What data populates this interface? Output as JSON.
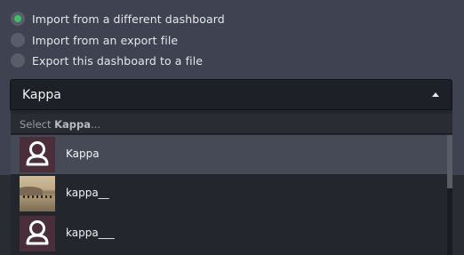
{
  "radio_options": [
    {
      "label": "Import from a different dashboard",
      "checked": true
    },
    {
      "label": "Import from an export file",
      "checked": false
    },
    {
      "label": "Export this dashboard to a file",
      "checked": false
    }
  ],
  "select": {
    "value": "Kappa",
    "search_prefix": "Select ",
    "search_term": "Kappa",
    "search_suffix": "..."
  },
  "options": [
    {
      "label": "Kappa",
      "icon": "user-icon",
      "selected": true
    },
    {
      "label": "kappa__",
      "icon": "photo-thumbnail",
      "selected": false
    },
    {
      "label": "kappa___",
      "icon": "user-icon",
      "selected": false
    }
  ],
  "colors": {
    "accent": "#3fbf6b",
    "panel": "#3f4250",
    "dropdown": "#24262d",
    "selected_row": "#464a57",
    "avatar_bg": "#4a2f3a"
  }
}
